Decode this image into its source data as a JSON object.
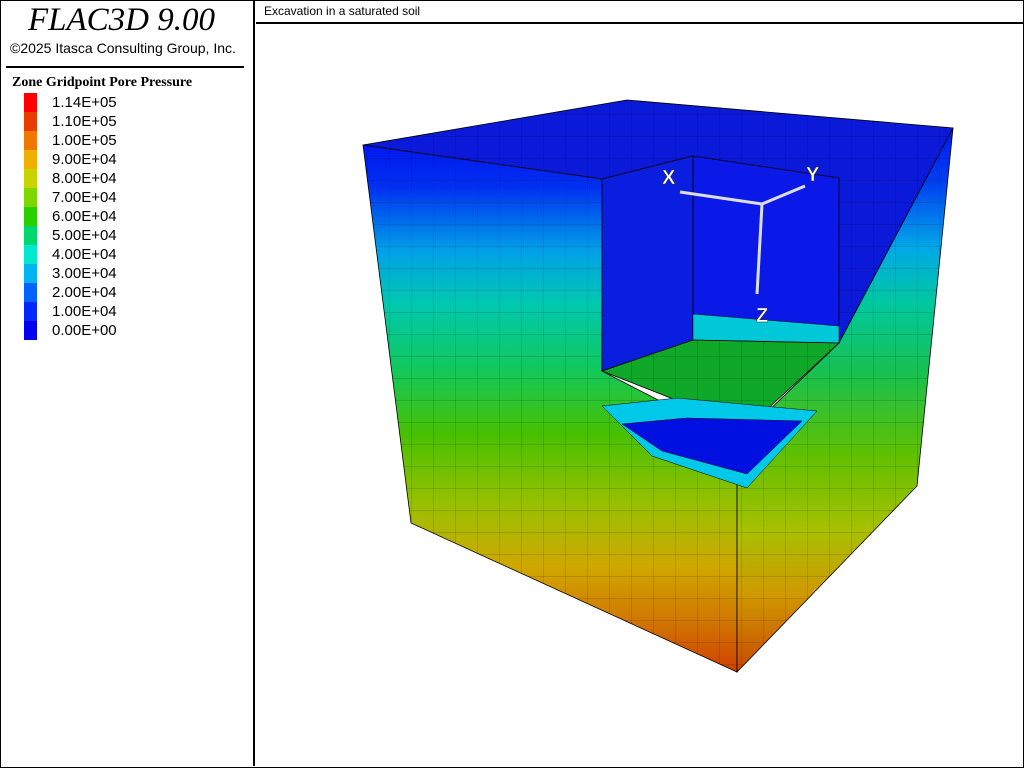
{
  "app": {
    "title": "FLAC3D 9.00",
    "copyright": "©2025 Itasca Consulting Group, Inc."
  },
  "plot": {
    "title": "Excavation in a saturated soil"
  },
  "legend": {
    "title": "Zone Gridpoint Pore Pressure",
    "items": [
      {
        "label": "1.14E+05",
        "color": "#ff0000"
      },
      {
        "label": "1.10E+05",
        "color": "#e83c00"
      },
      {
        "label": "1.00E+05",
        "color": "#f07800"
      },
      {
        "label": "9.00E+04",
        "color": "#f0b000"
      },
      {
        "label": "8.00E+04",
        "color": "#c8d400"
      },
      {
        "label": "7.00E+04",
        "color": "#7ed800"
      },
      {
        "label": "6.00E+04",
        "color": "#28d000"
      },
      {
        "label": "5.00E+04",
        "color": "#00d86e"
      },
      {
        "label": "4.00E+04",
        "color": "#00e8d0"
      },
      {
        "label": "3.00E+04",
        "color": "#00b4f0"
      },
      {
        "label": "2.00E+04",
        "color": "#0064ff"
      },
      {
        "label": "1.00E+04",
        "color": "#0028ff"
      },
      {
        "label": "0.00E+00",
        "color": "#0000f0"
      }
    ]
  },
  "axes": {
    "x_label": "X",
    "y_label": "Y",
    "z_label": "Z"
  }
}
